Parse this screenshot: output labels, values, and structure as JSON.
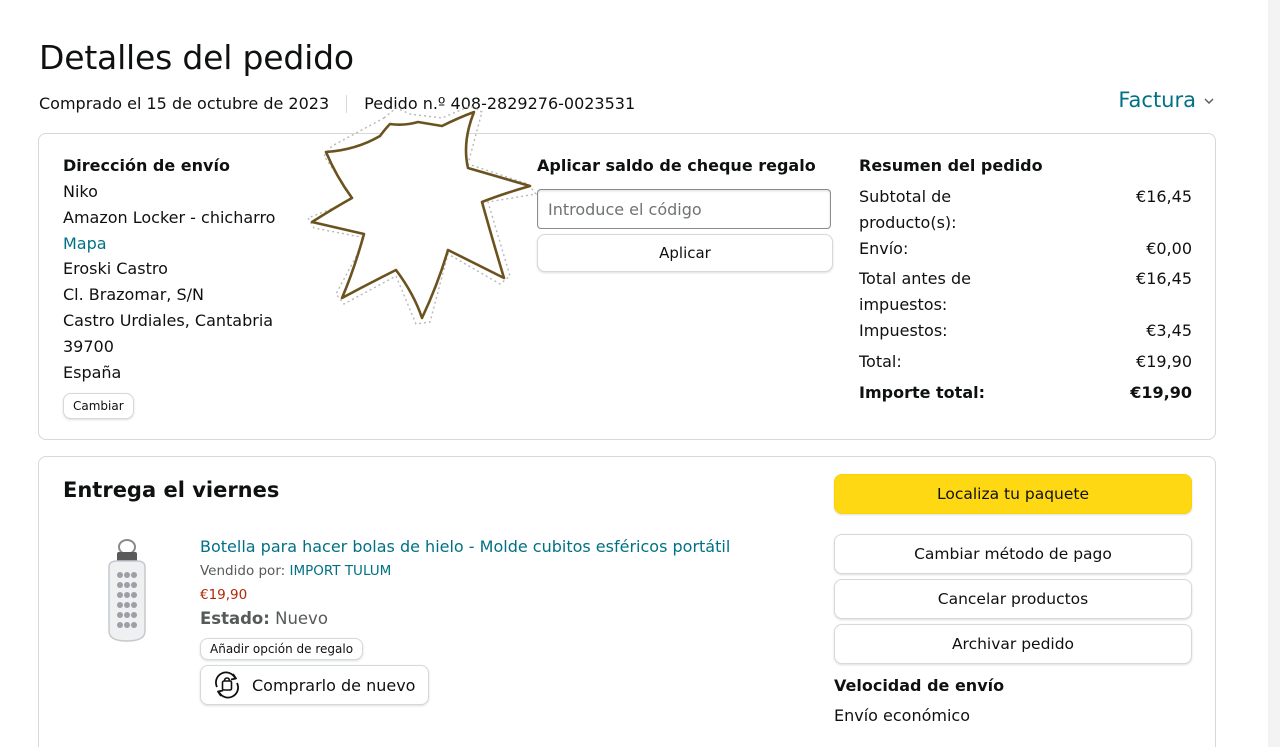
{
  "page": {
    "title": "Detalles del pedido",
    "purchase_date": "Comprado el 15 de octubre de 2023",
    "order_number": "Pedido n.º 408-2829276-0023531",
    "invoice_label": "Factura"
  },
  "shipping_address": {
    "title": "Dirección de envío",
    "name": "Niko",
    "line1": "Amazon Locker - chicharro",
    "map_link": "Mapa",
    "line2": "Eroski Castro",
    "line3": "Cl. Brazomar, S/N",
    "line4": "Castro Urdiales, Cantabria",
    "postal": "39700",
    "country": "España",
    "change_button": "Cambiar"
  },
  "gift_card": {
    "title": "Aplicar saldo de cheque regalo",
    "placeholder": "Introduce el código",
    "apply_button": "Aplicar"
  },
  "order_summary": {
    "title": "Resumen del pedido",
    "rows": [
      {
        "label": "Subtotal de producto(s):",
        "value": "€16,45"
      },
      {
        "label": "Envío:",
        "value": "€0,00"
      },
      {
        "label": "Total antes de impuestos:",
        "value": "€16,45"
      },
      {
        "label": "Impuestos:",
        "value": "€3,45"
      },
      {
        "label": "Total:",
        "value": "€19,90"
      },
      {
        "label": "Importe total:",
        "value": "€19,90"
      }
    ]
  },
  "delivery": {
    "title": "Entrega el viernes",
    "product": {
      "title": "Botella para hacer bolas de hielo - Molde cubitos esféricos portátil",
      "sold_by_label": "Vendido por:",
      "seller": "IMPORT TULUM",
      "price": "€19,90",
      "condition_label": "Estado:",
      "condition_value": "Nuevo",
      "gift_option_button": "Añadir opción de regalo",
      "buy_again_button": "Comprarlo de nuevo"
    },
    "actions": {
      "track": "Localiza tu paquete",
      "change_payment": "Cambiar método de pago",
      "cancel": "Cancelar productos",
      "archive": "Archivar pedido"
    },
    "shipping_speed_title": "Velocidad de envío",
    "shipping_speed_value": "Envío económico"
  },
  "colors": {
    "link": "#007185",
    "price": "#b12704",
    "primary_button": "#ffd814",
    "starburst_stroke": "#6b5320"
  },
  "icons": {
    "invoice_chevron": "chevron-down-icon",
    "buy_again": "buy-again-cycle-icon",
    "annotation": "starburst-annotation"
  }
}
